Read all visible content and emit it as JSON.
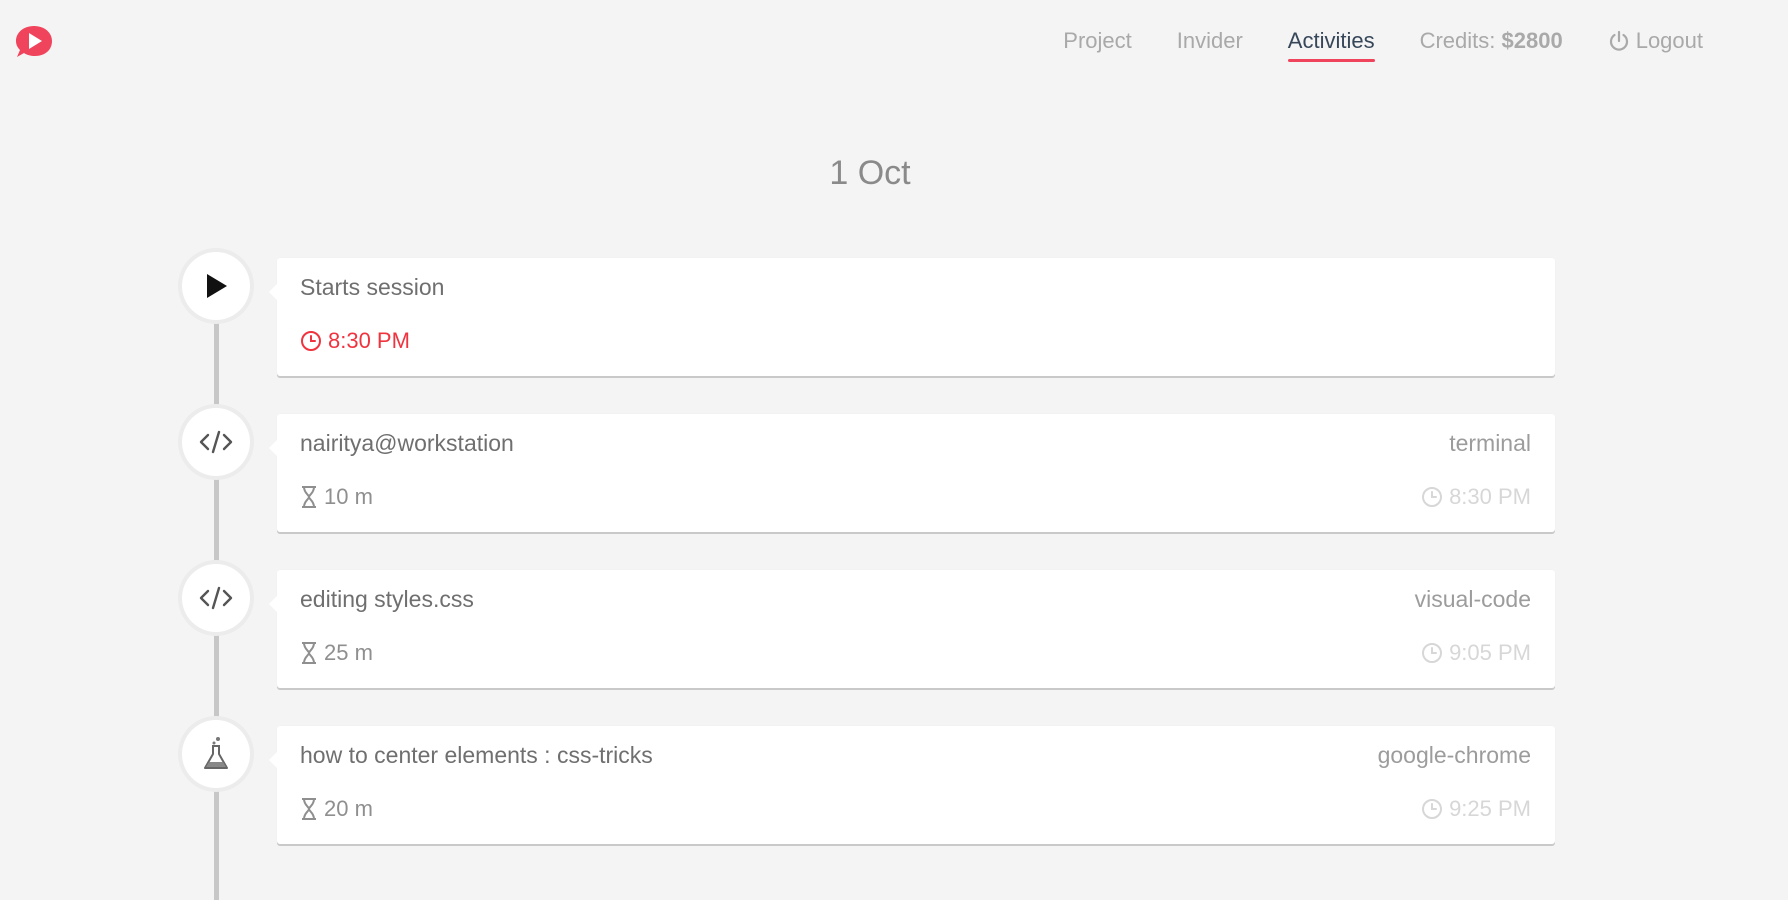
{
  "nav": {
    "items": [
      {
        "label": "Project"
      },
      {
        "label": "Invider"
      },
      {
        "label": "Activities"
      }
    ],
    "credits_label": "Credits:",
    "credits_value": "$2800",
    "logout_label": "Logout"
  },
  "date_heading": "1 Oct",
  "colors": {
    "accent": "#f0435c",
    "time_accent": "#f0343f",
    "background": "#f4f4f4"
  },
  "timeline": [
    {
      "icon": "play-icon",
      "title": "Starts session",
      "time": "8:30 PM"
    },
    {
      "icon": "code-icon",
      "title": "nairitya@workstation",
      "app": "terminal",
      "duration": "10 m",
      "time": "8:30 PM"
    },
    {
      "icon": "code-icon",
      "title": "editing styles.css",
      "app": "visual-code",
      "duration": "25 m",
      "time": "9:05 PM"
    },
    {
      "icon": "flask-icon",
      "title": "how to center elements : css-tricks",
      "app": "google-chrome",
      "duration": "20 m",
      "time": "9:25 PM"
    }
  ]
}
